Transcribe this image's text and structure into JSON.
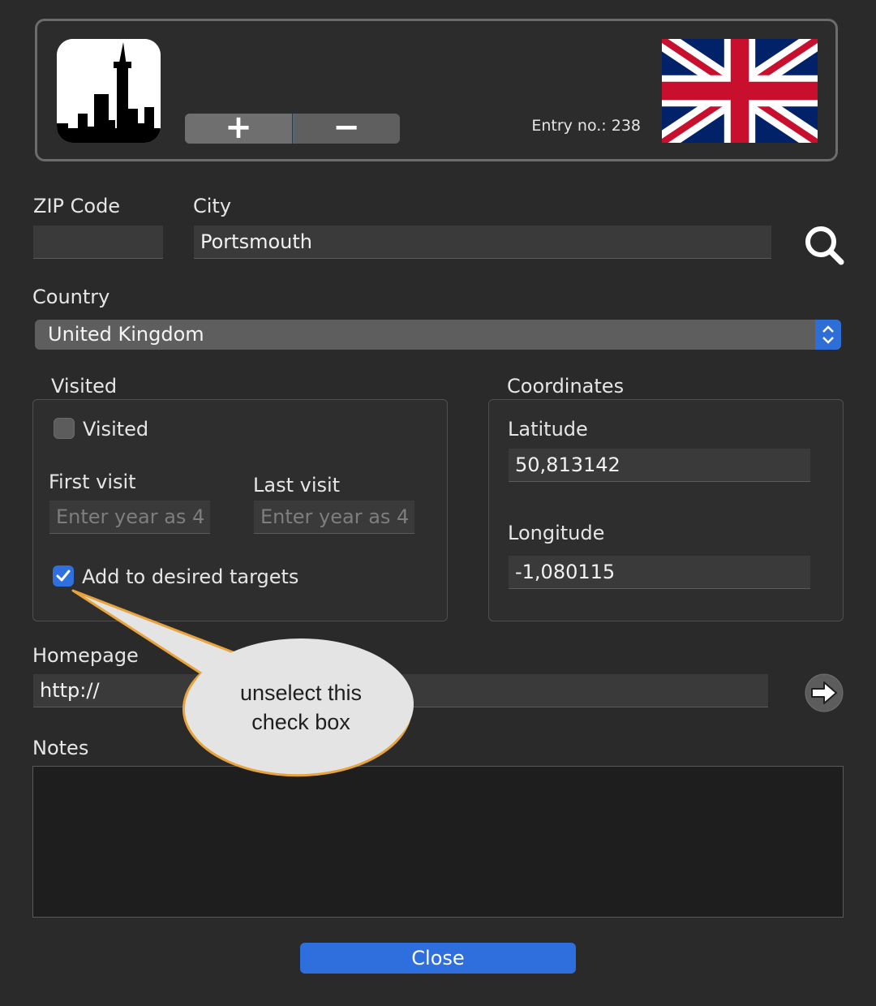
{
  "header": {
    "city_icon": "city-skyline-icon",
    "add_label": "+",
    "remove_label": "−",
    "entry_label": "Entry no.: 238",
    "flag_icon": "union-jack-flag"
  },
  "location": {
    "zip_label": "ZIP Code",
    "zip_value": "",
    "city_label": "City",
    "city_value": "Portsmouth",
    "search_icon": "search-icon"
  },
  "country": {
    "label": "Country",
    "selected": "United Kingdom",
    "accent": "#2d6fd6"
  },
  "visited": {
    "group_label": "Visited",
    "checkbox_label": "Visited",
    "checked": false,
    "first_visit_label": "First visit",
    "first_visit_placeholder": "Enter year as 4",
    "last_visit_label": "Last visit",
    "last_visit_placeholder": "Enter year as 4",
    "desired_label": "Add to desired targets",
    "desired_checked": true
  },
  "coordinates": {
    "group_label": "Coordinates",
    "latitude_label": "Latitude",
    "latitude_value": "50,813142",
    "longitude_label": "Longitude",
    "longitude_value": "-1,080115"
  },
  "homepage": {
    "label": "Homepage",
    "value": "http://",
    "go_icon": "arrow-right-icon"
  },
  "notes": {
    "label": "Notes",
    "value": ""
  },
  "footer": {
    "close_label": "Close"
  },
  "callout": {
    "line1": "unselect this",
    "line2": "check box"
  }
}
